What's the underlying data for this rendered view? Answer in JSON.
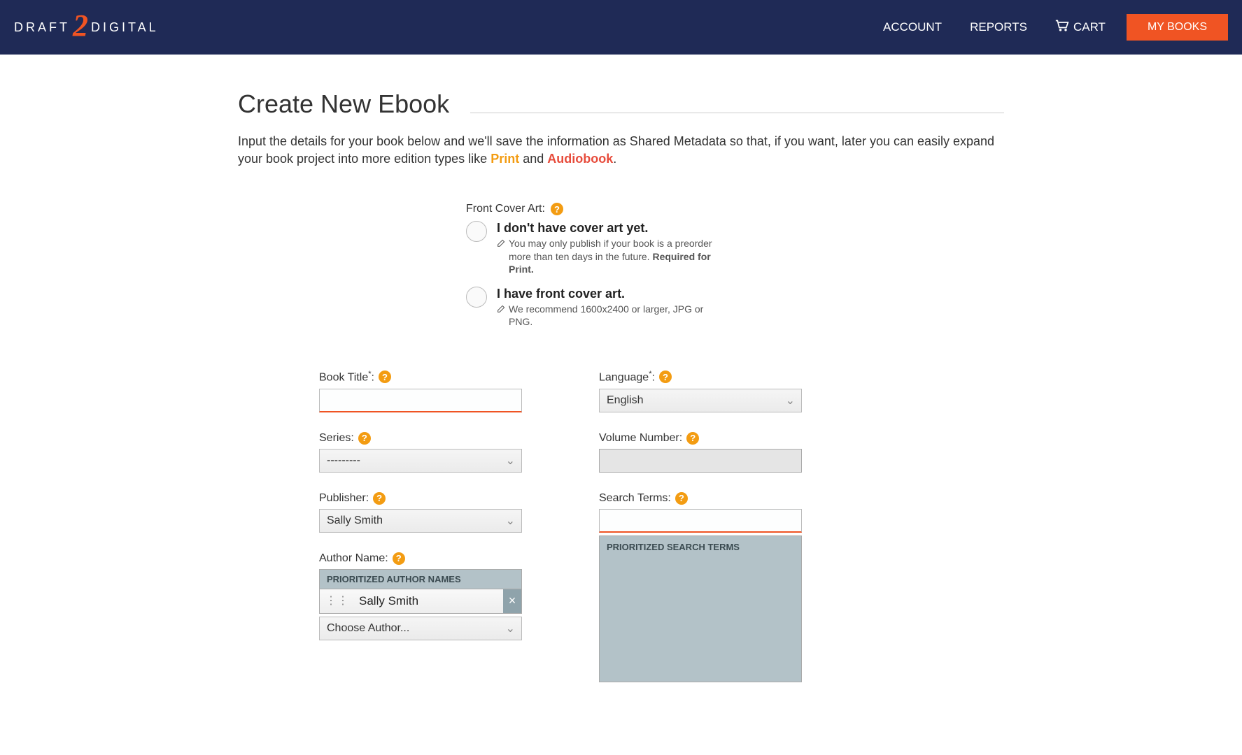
{
  "header": {
    "logo_left": "DRAFT",
    "logo_right": "DIGITAL",
    "nav": {
      "account": "ACCOUNT",
      "reports": "REPORTS",
      "cart": "CART",
      "mybooks": "MY BOOKS"
    }
  },
  "page": {
    "title": "Create New Ebook",
    "intro_before": "Input the details for your book below and we'll save the information as Shared Metadata so that, if you want, later you can easily expand your book project into more edition types like ",
    "intro_print": "Print",
    "intro_and": " and ",
    "intro_audiobook": "Audiobook",
    "intro_after": "."
  },
  "coverart": {
    "label": "Front Cover Art:",
    "opt1_title": "I don't have cover art yet.",
    "opt1_desc_a": "You may only publish if your book is a preorder more than ten days in the future. ",
    "opt1_desc_b": "Required for Print.",
    "opt2_title": "I have front cover art.",
    "opt2_desc": "We recommend 1600x2400 or larger, JPG or PNG."
  },
  "form": {
    "book_title_label": "Book Title",
    "series_label": "Series:",
    "series_value": "---------",
    "publisher_label": "Publisher:",
    "publisher_value": "Sally Smith",
    "author_label": "Author Name:",
    "prio_authors_header": "PRIORITIZED AUTHOR NAMES",
    "author_chip_name": "Sally Smith",
    "choose_author": "Choose Author...",
    "language_label": "Language",
    "language_value": "English",
    "volume_label": "Volume Number:",
    "search_terms_label": "Search Terms:",
    "prio_search_header": "PRIORITIZED SEARCH TERMS"
  }
}
